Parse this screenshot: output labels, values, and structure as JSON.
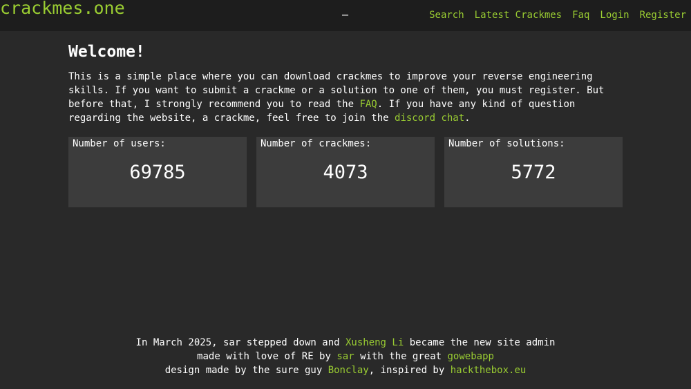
{
  "header": {
    "brand": "crackmes.one",
    "separator": "–",
    "nav": [
      {
        "label": "Search"
      },
      {
        "label": "Latest Crackmes"
      },
      {
        "label": "Faq"
      },
      {
        "label": "Login"
      },
      {
        "label": "Register"
      }
    ]
  },
  "main": {
    "title": "Welcome!",
    "intro": {
      "part1": "This is a simple place where you can download crackmes to improve your reverse engineering skills. If you want to submit a crackme or a solution to one of them, you must register. But before that, I strongly recommend you to read the ",
      "faq_link": "FAQ",
      "part2": ". If you have any kind of question regarding the website, a crackme, feel free to join the ",
      "discord_link": "discord chat",
      "part3": "."
    }
  },
  "stats": [
    {
      "label": "Number of users:",
      "value": "69785"
    },
    {
      "label": "Number of crackmes:",
      "value": "4073"
    },
    {
      "label": "Number of solutions:",
      "value": "5772"
    }
  ],
  "footer": {
    "line1_a": "In March 2025, sar stepped down and ",
    "line1_link": "Xusheng Li",
    "line1_b": " became the new site admin",
    "line2_a": "made with love of RE by ",
    "line2_link1": "sar",
    "line2_b": " with the great ",
    "line2_link2": "gowebapp",
    "line3_a": "design made by the sure guy ",
    "line3_link1": "Bonclay",
    "line3_b": ", inspired by ",
    "line3_link2": "hackthebox.eu"
  },
  "colors": {
    "background": "#292929",
    "header_background": "#1d1d1d",
    "card_background": "#3c3c3c",
    "accent": "#9acd32",
    "text": "#ffffff"
  }
}
